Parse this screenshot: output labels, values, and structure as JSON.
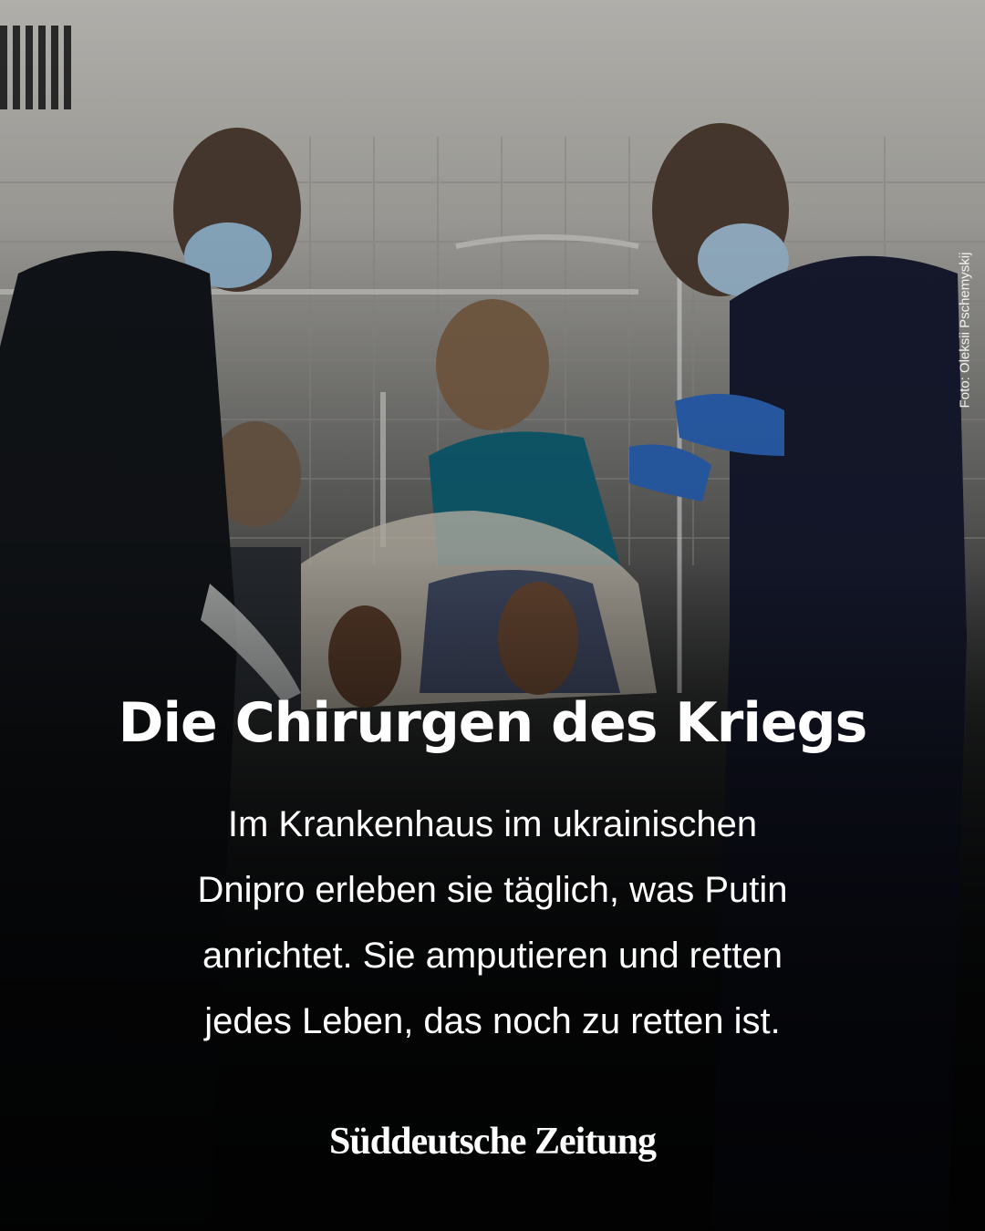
{
  "photo_credit": "Foto: Oleksii Pschemyskij",
  "headline": "Die Chirurgen des Kriegs",
  "body_lines": [
    "Im Krankenhaus im ukrainischen",
    "Dnipro erleben sie täglich, was Putin",
    "anrichtet. Sie amputieren und retten",
    "jedes Leben, das noch zu retten ist."
  ],
  "brand": "Süddeutsche Zeitung",
  "colors": {
    "text": "#ffffff",
    "background": "#0d0f11"
  }
}
